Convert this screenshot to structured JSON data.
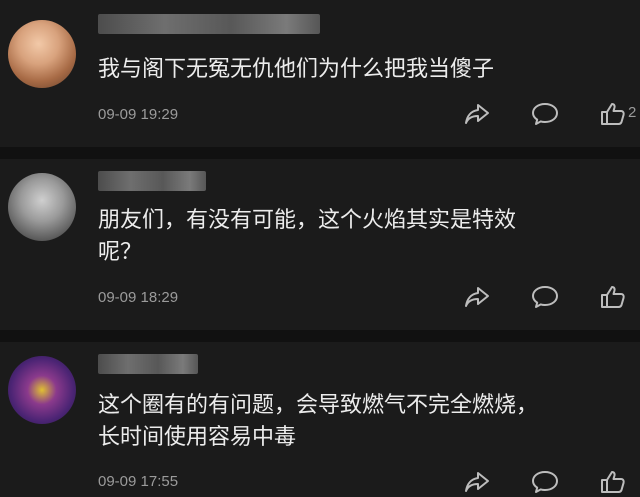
{
  "comments": [
    {
      "text": "我与阁下无冤无仇他们为什么把我当傻子",
      "time": "09-09 19:29",
      "like_count": "2"
    },
    {
      "text": "朋友们，有没有可能，这个火焰其实是特效\n呢？",
      "time": "09-09 18:29",
      "like_count": ""
    },
    {
      "text": "这个圈有的有问题，会导致燃气不完全燃烧，\n长时间使用容易中毒",
      "time": "09-09 17:55",
      "like_count": ""
    }
  ],
  "icons": {
    "share": "share-icon",
    "reply": "reply-icon",
    "like": "thumbs-up-icon"
  },
  "colors": {
    "background": "#1b1b1b",
    "separator": "#111111",
    "text": "#ececec",
    "meta": "#9b9b9b",
    "icon": "#bdbdbd"
  }
}
